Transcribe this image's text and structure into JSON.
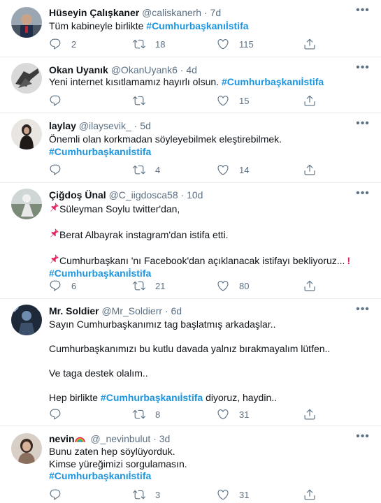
{
  "tweets": [
    {
      "name": "Hüseyin Çalışkaner",
      "handle": "@caliskanerh",
      "dot": "·",
      "time": "7d",
      "text": "Tüm kabineyle birlikte",
      "hashtag": "#Cumhurbaşkanıİstifa",
      "replies": "2",
      "retweets": "18",
      "likes": "115"
    },
    {
      "name": "Okan Uyanık",
      "handle": "@OkanUyank6",
      "dot": "·",
      "time": "4d",
      "text": "Yeni internet kısıtlamamız hayırlı olsun.",
      "hashtag": "#Cumhurbaşkanıİstifa",
      "replies": "",
      "retweets": "",
      "likes": "15"
    },
    {
      "name": "laylay",
      "handle": "@ilaysevik_",
      "dot": "·",
      "time": "5d",
      "text": "Önemli olan korkmadan söyleyebilmek eleştirebilmek.",
      "hashtag": "#Cumhurbaşkanıİstifa",
      "replies": "",
      "retweets": "4",
      "likes": "14"
    },
    {
      "name": "Çiğdoş Ünal",
      "handle": "@C_iigdosca58",
      "dot": "·",
      "time": "10d",
      "line1": "Süleyman Soylu twitter'dan,",
      "line2": "Berat Albayrak instagram'dan istifa etti.",
      "line3": "Cumhurbaşkanı 'nı Facebook'dan açıklanacak istifayı bekliyoruz...",
      "hashtag": "#Cumhurbaşkanıİstifa",
      "replies": "6",
      "retweets": "21",
      "likes": "80"
    },
    {
      "name": "Mr. Soldier",
      "handle": "@Mr_Soldierr",
      "dot": "·",
      "time": "6d",
      "line1": "Sayın Cumhurbaşkanımız tag başlatmış arkadaşlar..",
      "line2": "Cumhurbaşkanımızı bu kutlu davada yalnız bırakmayalım lütfen..",
      "line3": "Ve taga destek olalım..",
      "line4_pre": "Hep birlikte",
      "hashtag": "#Cumhurbaşkanıİstifa",
      "line4_post": "diyoruz, haydin..",
      "replies": "",
      "retweets": "8",
      "likes": "31"
    },
    {
      "name": "nevin",
      "handle": "@_nevinbulut",
      "dot": "·",
      "time": "3d",
      "line1": "Bunu zaten hep söylüyorduk.",
      "line2": "Kimse yüreğimizi sorgulamasın.",
      "hashtag": "#Cumhurbaşkanıİstifa",
      "replies": "",
      "retweets": "3",
      "likes": "31"
    }
  ],
  "icons": {
    "reply": "reply-icon",
    "retweet": "retweet-icon",
    "like": "like-icon",
    "share": "share-icon",
    "more": "more-icon",
    "pin": "pushpin-emoji",
    "exclaim": "red-exclamation-emoji",
    "rainbow": "rainbow-emoji"
  },
  "colors": {
    "accent": "#1b95e0",
    "secondary_text": "#5b7083",
    "divider": "#e6ecf0"
  }
}
